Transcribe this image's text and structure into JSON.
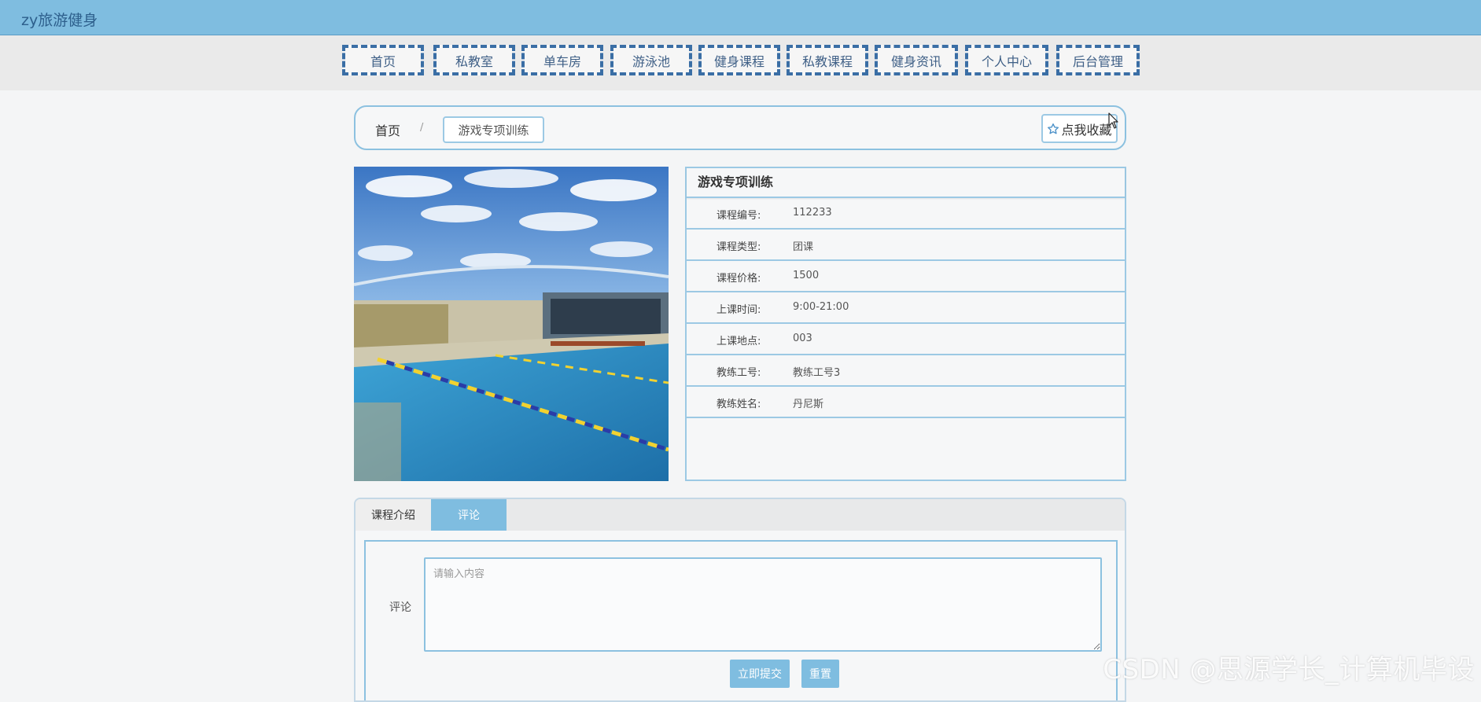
{
  "header": {
    "brand": "zy旅游健身"
  },
  "nav": {
    "items": [
      {
        "label": "首页"
      },
      {
        "label": "私教室"
      },
      {
        "label": "单车房"
      },
      {
        "label": "游泳池"
      },
      {
        "label": "健身课程"
      },
      {
        "label": "私教课程"
      },
      {
        "label": "健身资讯"
      },
      {
        "label": "个人中心"
      },
      {
        "label": "后台管理"
      }
    ]
  },
  "breadcrumb": {
    "home": "首页",
    "separator": "/",
    "current": "游戏专项训练"
  },
  "favorite": {
    "label": "点我收藏",
    "icon": "star-outline-icon"
  },
  "detail": {
    "title": "游戏专项训练",
    "image_alt_icon": "swimming-pool-photo",
    "fields": [
      {
        "label": "课程编号:",
        "value": "112233"
      },
      {
        "label": "课程类型:",
        "value": "团课"
      },
      {
        "label": "课程价格:",
        "value": "1500"
      },
      {
        "label": "上课时间:",
        "value": "9:00-21:00"
      },
      {
        "label": "上课地点:",
        "value": "003"
      },
      {
        "label": "教练工号:",
        "value": "教练工号3"
      },
      {
        "label": "教练姓名:",
        "value": "丹尼斯"
      }
    ]
  },
  "tabs": {
    "intro": "课程介绍",
    "comment": "评论",
    "active": "comment"
  },
  "comment_form": {
    "label": "评论",
    "placeholder": "请输入内容",
    "value": "",
    "submit": "立即提交",
    "reset": "重置"
  },
  "watermark": "CSDN @思源学长_计算机毕设",
  "colors": {
    "topbar": "#7fbde0",
    "accent": "#7fbde0",
    "border": "#9cc9e4",
    "nav_border": "#3a6ea5"
  }
}
